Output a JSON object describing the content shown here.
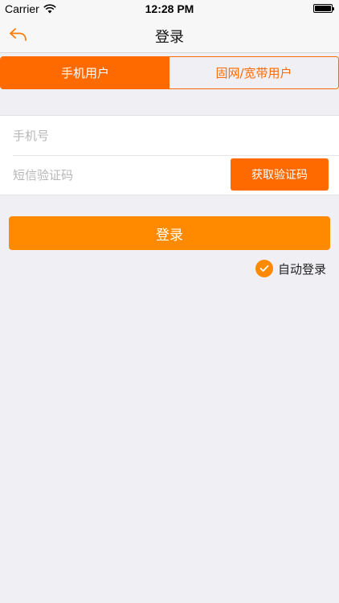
{
  "status_bar": {
    "carrier": "Carrier",
    "time": "12:28 PM"
  },
  "nav": {
    "title": "登录",
    "back_icon": "reply-arrow-icon"
  },
  "tabs": [
    {
      "label": "手机用户",
      "active": true
    },
    {
      "label": "固网/宽带用户",
      "active": false
    }
  ],
  "form": {
    "phone_placeholder": "手机号",
    "sms_placeholder": "短信验证码",
    "get_code_label": "获取验证码"
  },
  "login_button": "登录",
  "auto_login": {
    "label": "自动登录",
    "checked": true
  },
  "colors": {
    "accent": "#ff6a00",
    "button": "#ff8a00",
    "background": "#efeff4"
  }
}
